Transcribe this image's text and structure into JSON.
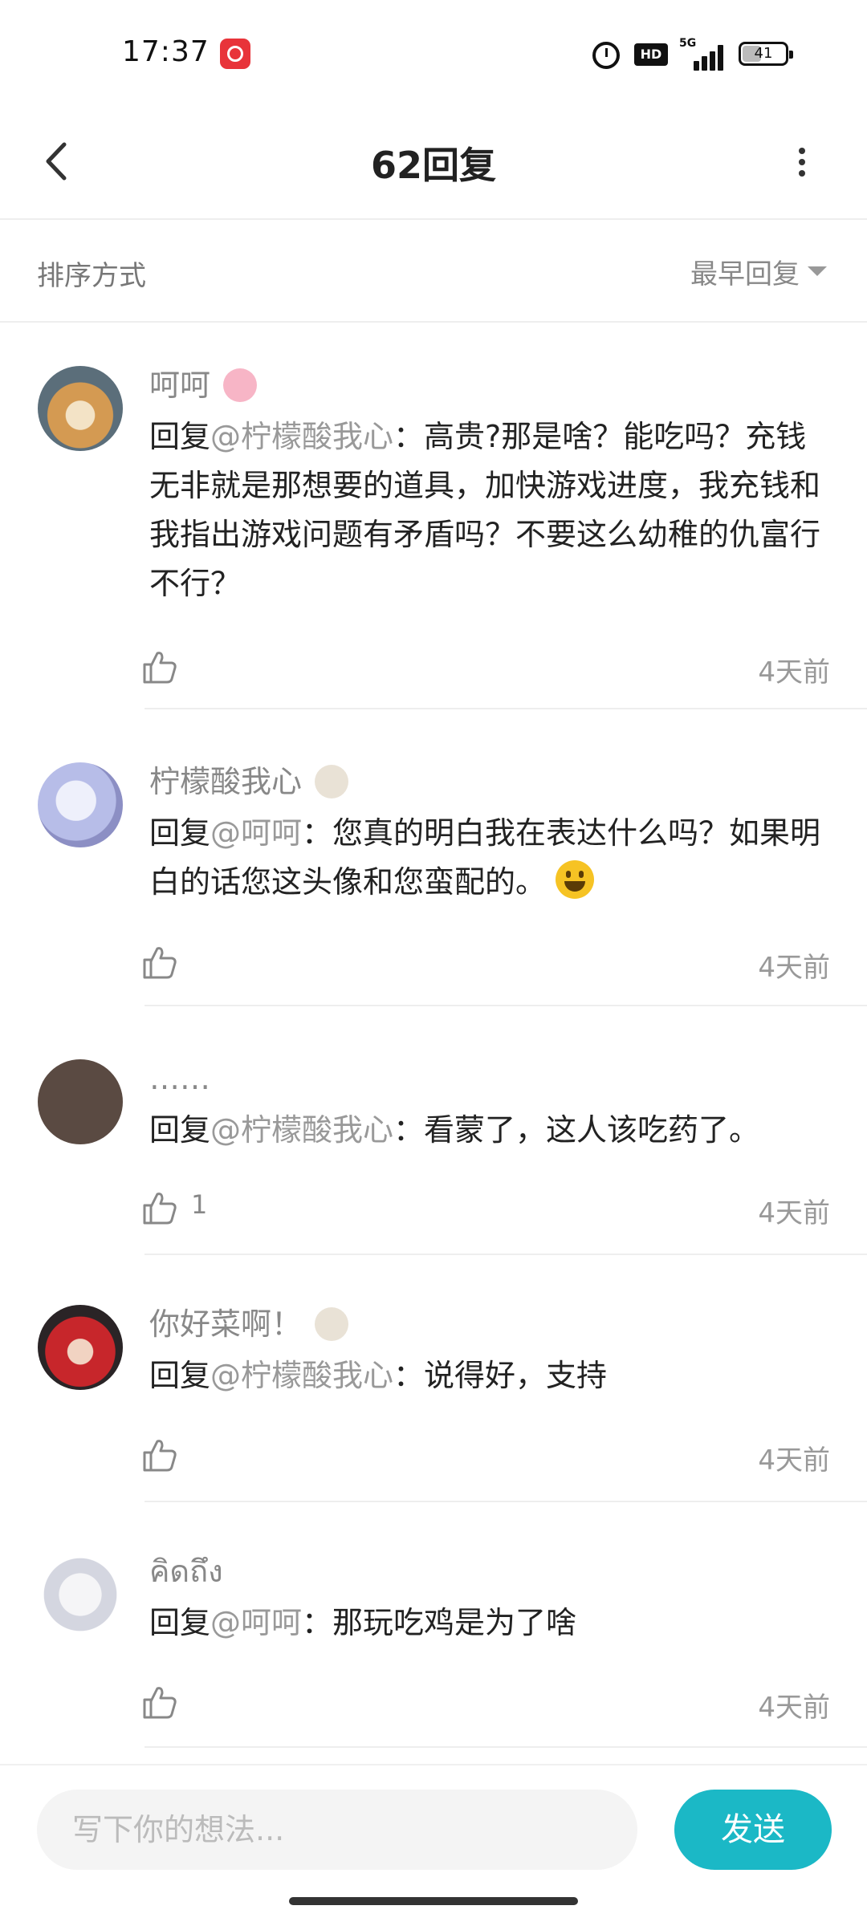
{
  "status_bar": {
    "time": "17:37",
    "hd_label": "HD",
    "network_label": "5G",
    "battery_level": "41",
    "icons": [
      "music-app-icon",
      "alarm-icon",
      "hd-icon",
      "signal-icon",
      "battery-icon"
    ]
  },
  "header": {
    "title": "62回复"
  },
  "sort": {
    "label": "排序方式",
    "value": "最早回复"
  },
  "comments": [
    {
      "name": "呵呵",
      "reply_prefix": "回复",
      "mention": "@柠檬酸我心",
      "text": "：高贵?那是啥？能吃吗？充钱无非就是那想要的道具，加快游戏进度，我充钱和我指出游戏问题有矛盾吗？不要这么幼稚的仇富行不行？",
      "likes": "",
      "time": "4天前"
    },
    {
      "name": "柠檬酸我心",
      "reply_prefix": "回复",
      "mention": "@呵呵",
      "text": "：您真的明白我在表达什么吗？如果明白的话您这头像和您蛮配的。",
      "likes": "",
      "time": "4天前"
    },
    {
      "name": "……",
      "reply_prefix": "回复",
      "mention": "@柠檬酸我心",
      "text": "：看蒙了，这人该吃药了。",
      "likes": "1",
      "time": "4天前"
    },
    {
      "name": "你好菜啊！",
      "reply_prefix": "回复",
      "mention": "@柠檬酸我心",
      "text": "：说得好，支持",
      "likes": "",
      "time": "4天前"
    },
    {
      "name": "คิดถึง",
      "reply_prefix": "回复",
      "mention": "@呵呵",
      "text": "：那玩吃鸡是为了啥",
      "likes": "",
      "time": "4天前"
    }
  ],
  "input": {
    "placeholder": "写下你的想法...",
    "send_label": "发送"
  },
  "colors": {
    "accent": "#1bb8c6",
    "mention": "#999999"
  }
}
